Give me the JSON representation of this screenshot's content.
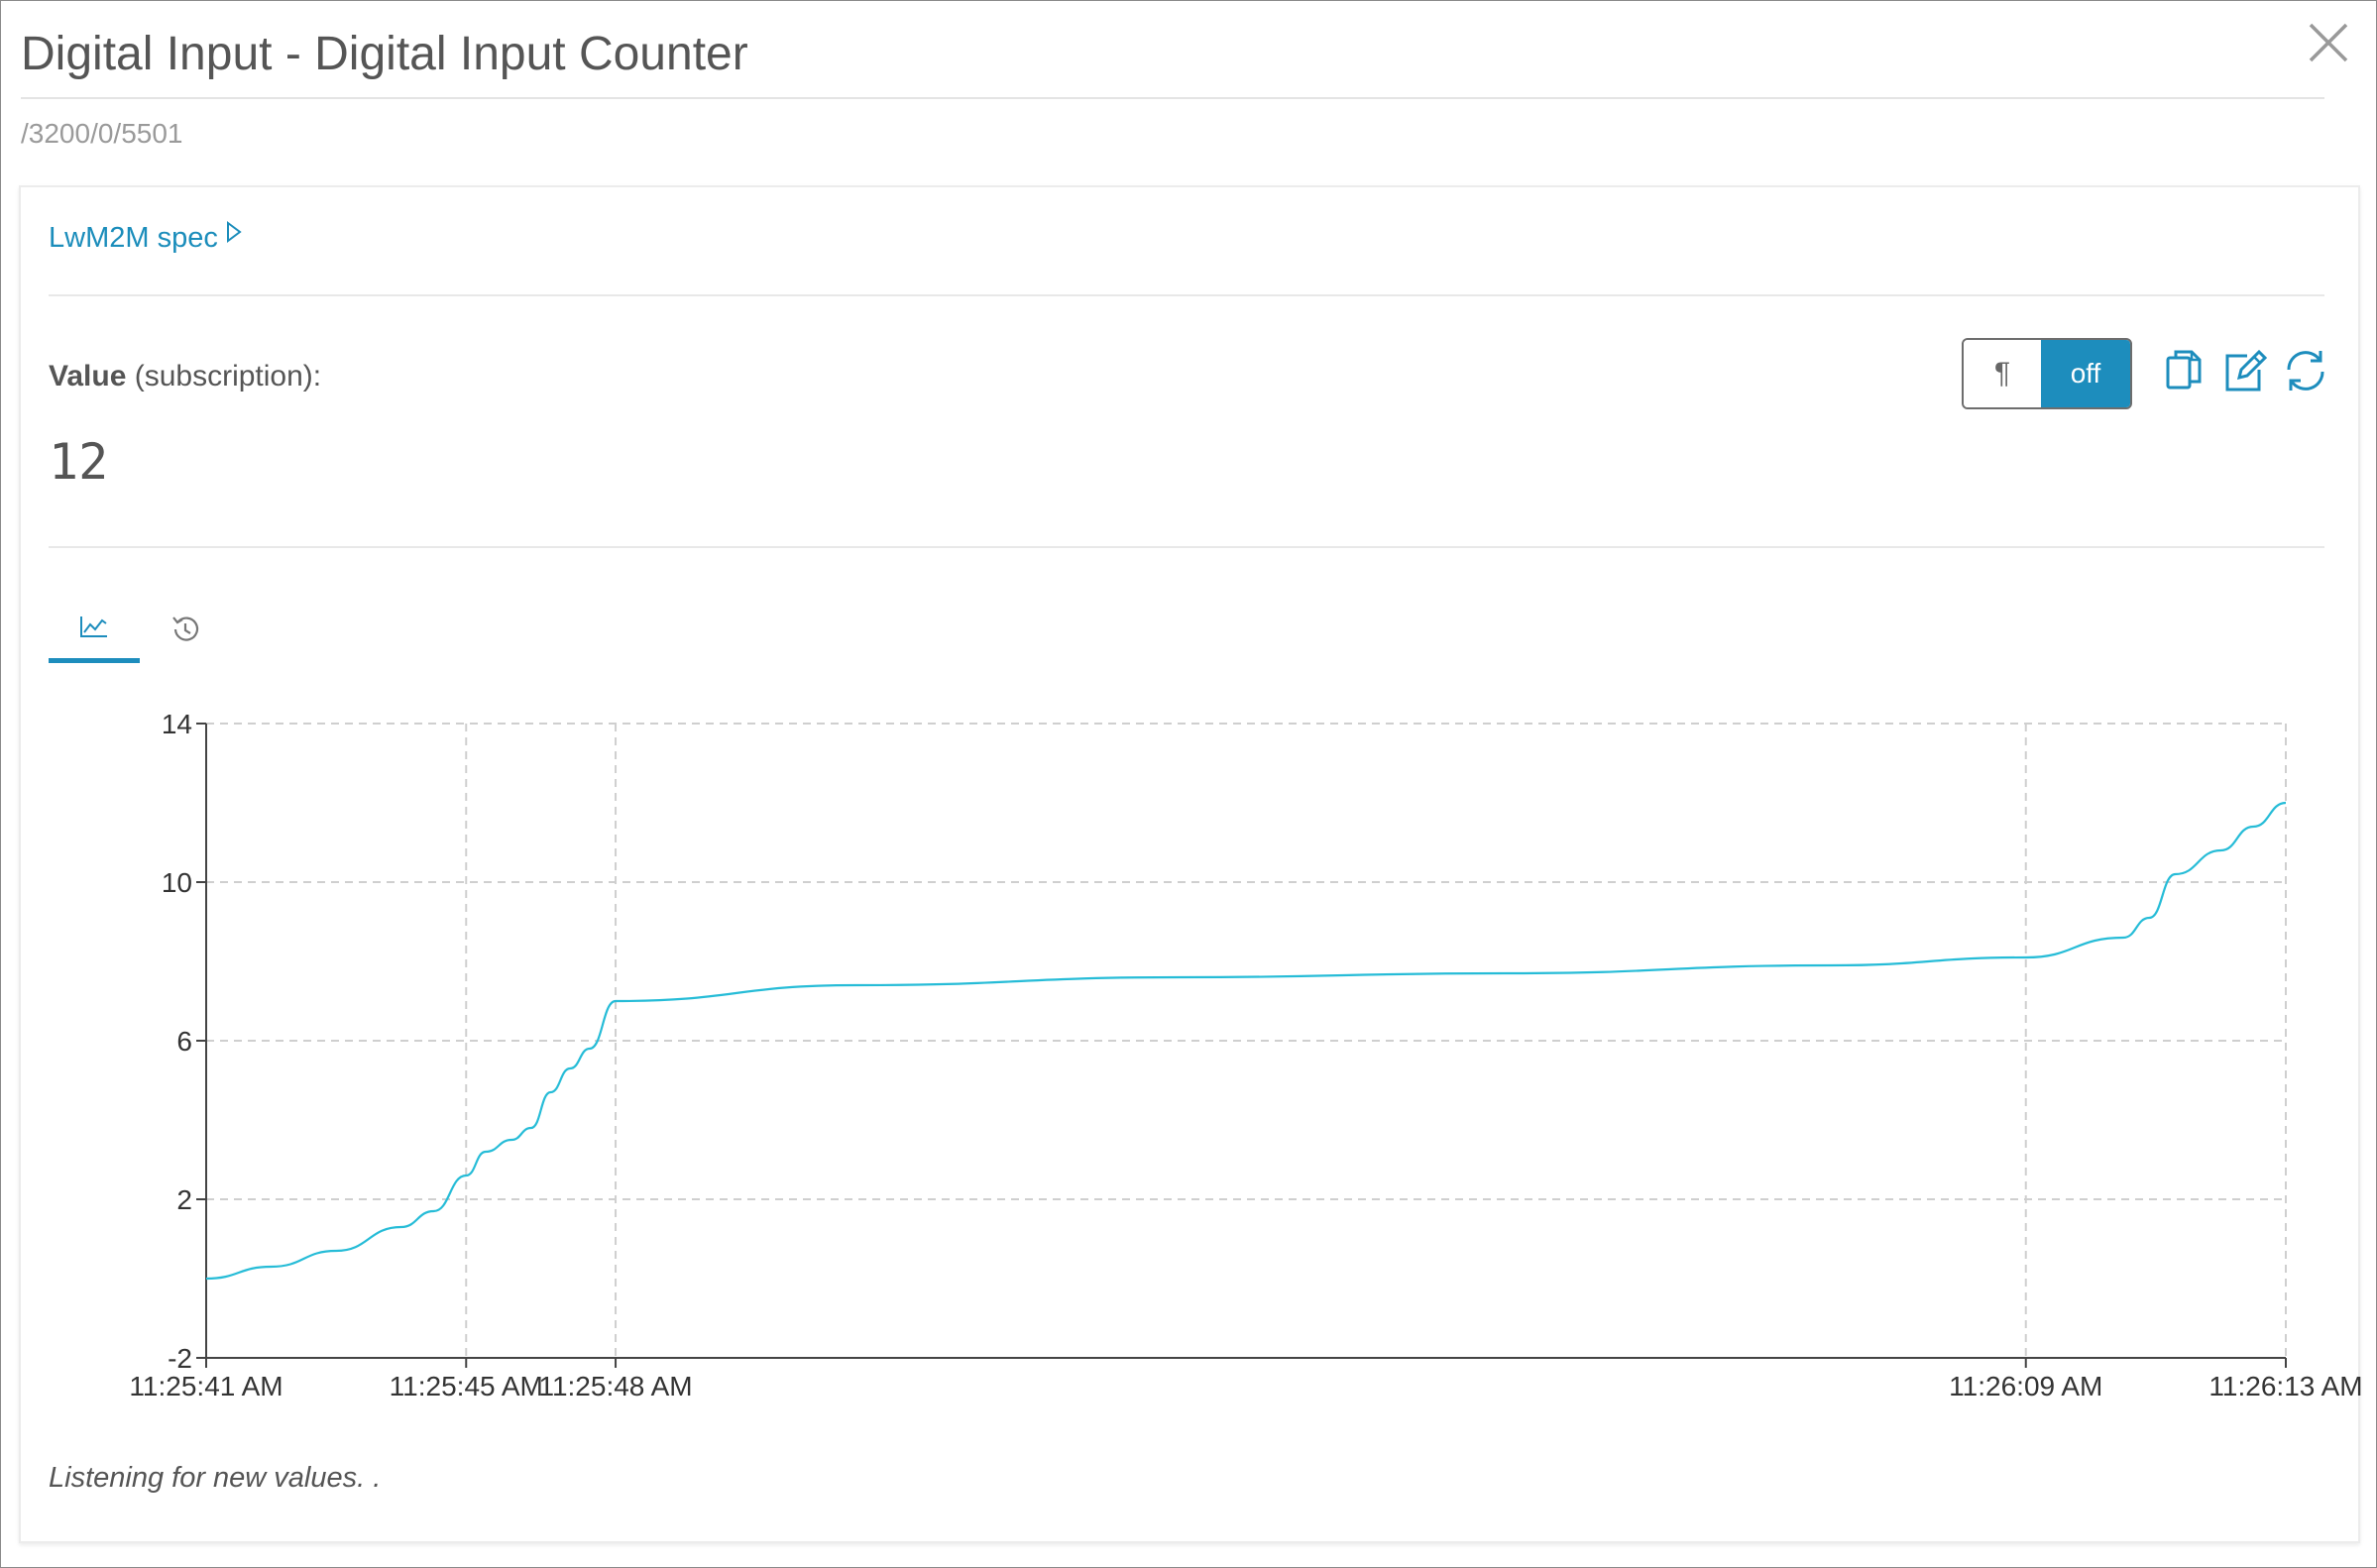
{
  "dialog": {
    "title": "Digital Input - Digital Input Counter",
    "path": "/3200/0/5501"
  },
  "spec": {
    "link_label": "LwM2M spec"
  },
  "value_section": {
    "label_bold": "Value",
    "label_rest": " (subscription):",
    "value": "12"
  },
  "toggle": {
    "pilcrow_label": "¶",
    "state_label": "off"
  },
  "icons": {
    "close": "close-icon",
    "copy": "copy-icon",
    "edit": "edit-icon",
    "refresh": "refresh-icon",
    "chart_tab": "line-chart-icon",
    "history_tab": "history-icon"
  },
  "colors": {
    "accent": "#1d8dbd",
    "series": "#26bcd7"
  },
  "status": "Listening for new values. .",
  "chart_data": {
    "type": "line",
    "x_ticks": [
      "11:25:41 AM",
      "11:25:45 AM",
      "11:25:48 AM",
      "11:26:09 AM",
      "11:26:13 AM"
    ],
    "x_seconds": [
      0,
      4,
      6.3,
      28,
      32
    ],
    "y_ticks": [
      "14",
      "10",
      "6",
      "2",
      "-2"
    ],
    "ylim": [
      -2,
      14
    ],
    "grid": true,
    "series": [
      {
        "x": [
          0,
          1,
          2,
          3,
          3.5,
          4,
          4.3,
          4.7,
          5.0,
          5.3,
          5.6,
          5.9,
          6.3,
          10,
          15,
          20,
          25,
          28,
          29.5,
          29.9,
          30.3,
          31,
          31.5,
          32
        ],
        "y": [
          0.0,
          0.3,
          0.7,
          1.3,
          1.7,
          2.6,
          3.2,
          3.5,
          3.8,
          4.7,
          5.3,
          5.8,
          7.0,
          7.4,
          7.6,
          7.7,
          7.9,
          8.1,
          8.6,
          9.1,
          10.2,
          10.8,
          11.4,
          12.0
        ]
      }
    ]
  }
}
